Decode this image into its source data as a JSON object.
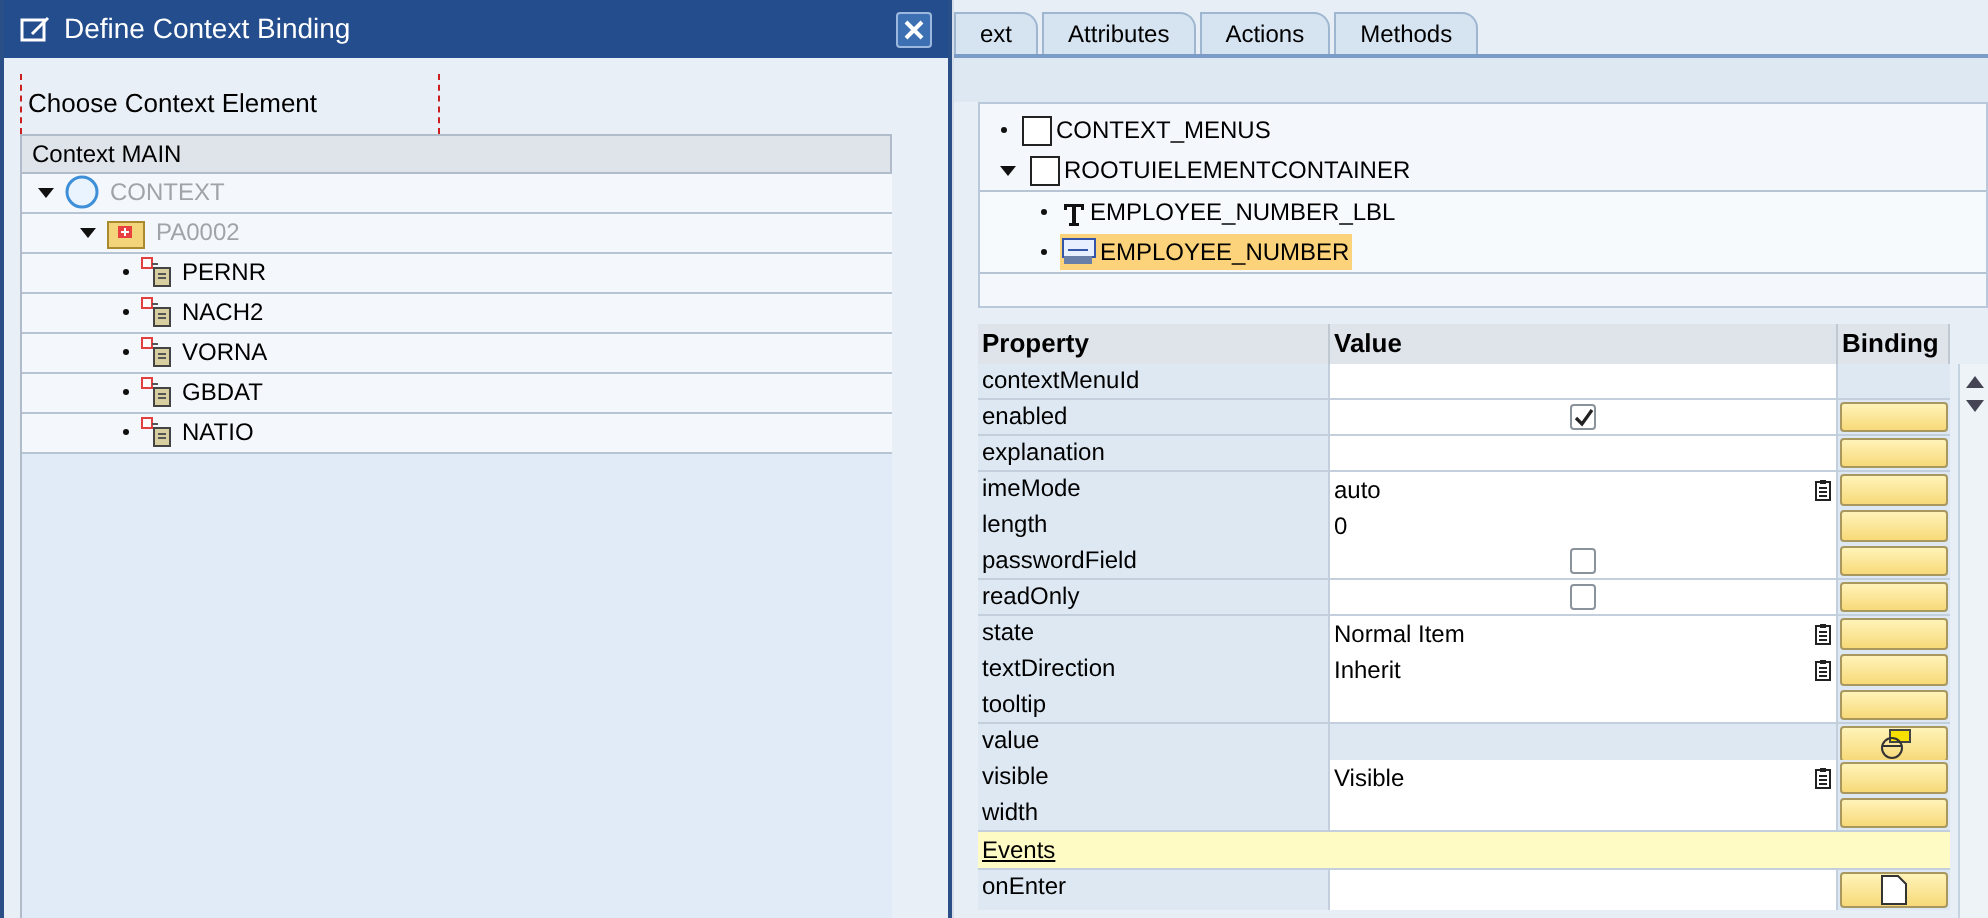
{
  "dialog": {
    "title": "Define Context Binding",
    "section_label": "Choose Context Element",
    "tree_header": "Context MAIN",
    "tree": [
      {
        "label": "CONTEXT",
        "kind": "root",
        "disabled": true,
        "expanded": true,
        "children": [
          {
            "label": "PA0002",
            "kind": "node",
            "disabled": true,
            "expanded": true,
            "children": [
              {
                "label": "PERNR",
                "kind": "attribute",
                "disabled": false
              },
              {
                "label": "NACH2",
                "kind": "attribute",
                "disabled": false
              },
              {
                "label": "VORNA",
                "kind": "attribute",
                "disabled": false
              },
              {
                "label": "GBDAT",
                "kind": "attribute",
                "disabled": false
              },
              {
                "label": "NATIO",
                "kind": "attribute",
                "disabled": false
              }
            ]
          }
        ]
      }
    ]
  },
  "tabs": [
    {
      "label": "ext",
      "selected": false
    },
    {
      "label": "Attributes",
      "selected": false
    },
    {
      "label": "Actions",
      "selected": false
    },
    {
      "label": "Methods",
      "selected": false
    }
  ],
  "element_tree": [
    {
      "label": "CONTEXT_MENUS",
      "kind": "container",
      "expanded": false,
      "selected": false
    },
    {
      "label": "ROOTUIELEMENTCONTAINER",
      "kind": "container",
      "expanded": true,
      "selected": false,
      "children": [
        {
          "label": "EMPLOYEE_NUMBER_LBL",
          "kind": "label",
          "selected": false
        },
        {
          "label": "EMPLOYEE_NUMBER",
          "kind": "input",
          "selected": true
        }
      ]
    }
  ],
  "properties": {
    "columns": [
      "Property",
      "Value",
      "Binding"
    ],
    "rows": [
      {
        "name": "contextMenuId",
        "kind": "text",
        "binding_button": false,
        "bound": false
      },
      {
        "name": "enabled",
        "kind": "checkbox",
        "checked": true,
        "binding_button": true,
        "bound": false
      },
      {
        "name": "explanation",
        "kind": "text",
        "binding_button": true,
        "bound": false
      },
      {
        "name": "imeMode",
        "kind": "dropdown",
        "value": "auto",
        "binding_button": true,
        "bound": false
      },
      {
        "name": "length",
        "kind": "text",
        "value": "0",
        "binding_button": true,
        "bound": false
      },
      {
        "name": "passwordField",
        "kind": "checkbox",
        "checked": false,
        "binding_button": true,
        "bound": false
      },
      {
        "name": "readOnly",
        "kind": "checkbox",
        "checked": false,
        "binding_button": true,
        "bound": false
      },
      {
        "name": "state",
        "kind": "dropdown",
        "value": "Normal Item",
        "binding_button": true,
        "bound": false
      },
      {
        "name": "textDirection",
        "kind": "dropdown",
        "value": "Inherit",
        "binding_button": true,
        "bound": false
      },
      {
        "name": "tooltip",
        "kind": "text",
        "binding_button": true,
        "bound": false
      },
      {
        "name": "value",
        "kind": "readonly",
        "binding_button": true,
        "bound": true
      },
      {
        "name": "visible",
        "kind": "dropdown",
        "value": "Visible",
        "binding_button": true,
        "bound": false
      },
      {
        "name": "width",
        "kind": "text",
        "binding_button": true,
        "bound": false
      }
    ],
    "section": "Events",
    "event_rows": [
      {
        "name": "onEnter",
        "kind": "event",
        "binding_button": true
      }
    ]
  }
}
